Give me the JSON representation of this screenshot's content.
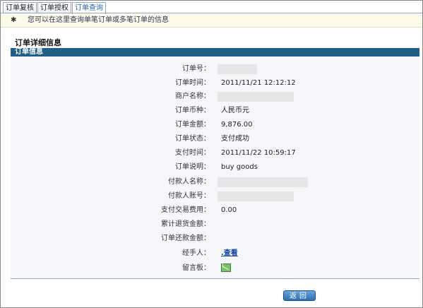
{
  "tabs": [
    {
      "label": "订单复核",
      "active": false
    },
    {
      "label": "订单授权",
      "active": false
    },
    {
      "label": "订单查询",
      "active": true
    }
  ],
  "notice": {
    "pin": "✱",
    "text": "您可以在这里查询单笔订单或多笔订单的信息"
  },
  "section": {
    "title": "订单详细信息",
    "bar_title": "订单信息"
  },
  "fields": [
    {
      "label": "订单号：",
      "value": "",
      "redacted": true
    },
    {
      "label": "订单时间：",
      "value": "2011/11/21 12:12:12"
    },
    {
      "label": "商户名称：",
      "value": "",
      "redacted": true
    },
    {
      "label": "订单币种：",
      "value": "人民币元"
    },
    {
      "label": "订单金额：",
      "value": "9,876.00"
    },
    {
      "label": "订单状态：",
      "value": "支付成功"
    },
    {
      "label": "支付时间：",
      "value": "2011/11/22 10:59:17"
    },
    {
      "label": "订单说明：",
      "value": "buy goods"
    },
    {
      "label": "付款人名称：",
      "value": "",
      "redacted": true
    },
    {
      "label": "付款人账号：",
      "value": "",
      "redacted": true
    },
    {
      "label": "支付交易费用：",
      "value": "0.00"
    },
    {
      "label": "累计退货金额：",
      "value": ""
    },
    {
      "label": "订单还款金额：",
      "value": ""
    },
    {
      "label": "经手人：",
      "value": ".查看",
      "link": true
    },
    {
      "label": "留言板：",
      "value": "",
      "icon": "message-icon"
    }
  ],
  "buttons": {
    "back": "返回"
  },
  "colors": {
    "section_bar": "#1f5f88",
    "notice_bg": "#fcfbe9",
    "link": "#1646a0",
    "button": "#2e6fb4"
  }
}
